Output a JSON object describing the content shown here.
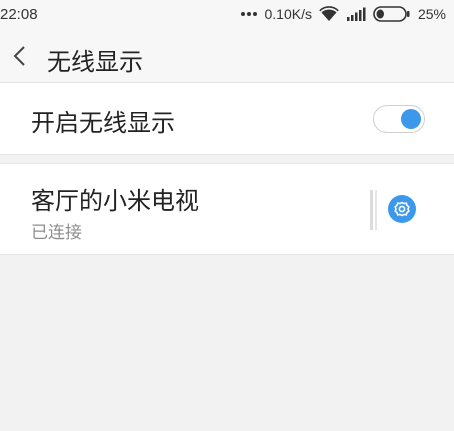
{
  "status_bar": {
    "time": "22:08",
    "network_speed": "0.10K/s",
    "battery_percent": "25%",
    "battery_level": 0.25
  },
  "header": {
    "title": "无线显示"
  },
  "settings": {
    "wireless_display_label": "开启无线显示",
    "wireless_display_enabled": true
  },
  "devices": [
    {
      "name": "客厅的小米电视",
      "status": "已连接"
    }
  ],
  "colors": {
    "accent": "#3c98ea",
    "background": "#f2f2f2"
  },
  "icons": {
    "back": "chevron-left-icon",
    "settings": "gear-icon",
    "wifi": "wifi-icon",
    "signal": "signal-icon",
    "battery": "battery-icon"
  }
}
